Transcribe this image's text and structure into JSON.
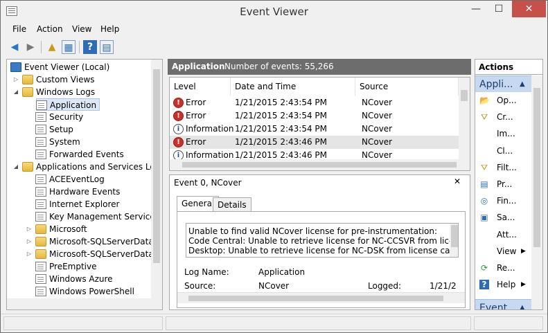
{
  "window": {
    "title": "Event Viewer",
    "min": "—",
    "max": "☐",
    "close": "✕"
  },
  "menubar": {
    "items": [
      "File",
      "Action",
      "View",
      "Help"
    ]
  },
  "toolbar": {
    "back": "◀",
    "forward": "▶",
    "up": "▲",
    "show": "▦",
    "help": "?",
    "props": "▤"
  },
  "tree": {
    "items": [
      {
        "label": "Event Viewer (Local)",
        "arrow": "",
        "icon": "monitor"
      },
      {
        "label": "Custom Views",
        "arrow": "▷",
        "icon": "folder"
      },
      {
        "label": "Windows Logs",
        "arrow": "◢",
        "icon": "folder"
      },
      {
        "label": "Application",
        "arrow": "",
        "icon": "log"
      },
      {
        "label": "Security",
        "arrow": "",
        "icon": "log"
      },
      {
        "label": "Setup",
        "arrow": "",
        "icon": "log"
      },
      {
        "label": "System",
        "arrow": "",
        "icon": "log"
      },
      {
        "label": "Forwarded Events",
        "arrow": "",
        "icon": "log"
      },
      {
        "label": "Applications and Services Logs",
        "arrow": "◢",
        "icon": "folder"
      },
      {
        "label": "ACEEventLog",
        "arrow": "",
        "icon": "log"
      },
      {
        "label": "Hardware Events",
        "arrow": "",
        "icon": "log"
      },
      {
        "label": "Internet Explorer",
        "arrow": "",
        "icon": "log"
      },
      {
        "label": "Key Management Service",
        "arrow": "",
        "icon": "log"
      },
      {
        "label": "Microsoft",
        "arrow": "▷",
        "icon": "folder"
      },
      {
        "label": "Microsoft-SQLServerDataTc",
        "arrow": "▷",
        "icon": "folder"
      },
      {
        "label": "Microsoft-SQLServerDataTc",
        "arrow": "▷",
        "icon": "folder"
      },
      {
        "label": "PreEmptive",
        "arrow": "",
        "icon": "log"
      },
      {
        "label": "Windows Azure",
        "arrow": "",
        "icon": "log"
      },
      {
        "label": "Windows PowerShell",
        "arrow": "",
        "icon": "log"
      }
    ]
  },
  "center": {
    "log_name": "Application",
    "count_label": "Number of events: 55,266"
  },
  "events": {
    "columns": [
      "Level",
      "Date and Time",
      "Source"
    ],
    "rows": [
      {
        "level": "Error",
        "date": "1/21/2015 2:43:54 PM",
        "source": "NCover"
      },
      {
        "level": "Error",
        "date": "1/21/2015 2:43:54 PM",
        "source": "NCover"
      },
      {
        "level": "Information",
        "date": "1/21/2015 2:43:54 PM",
        "source": "NCover"
      },
      {
        "level": "Error",
        "date": "1/21/2015 2:43:46 PM",
        "source": "NCover"
      },
      {
        "level": "Information",
        "date": "1/21/2015 2:43:46 PM",
        "source": "NCover"
      }
    ]
  },
  "detail": {
    "title": "Event 0, NCover",
    "close": "✕",
    "tabs": [
      "General",
      "Details"
    ],
    "message": [
      "Unable to find valid NCover license for pre-instrumentation:",
      "Code Central: Unable to retrieve license for NC-CCSVR from license cach",
      "Desktop: Unable to retrieve license for NC-DSK from license cache."
    ],
    "log_name_label": "Log Name:",
    "log_name_value": "Application",
    "source_label": "Source:",
    "source_value": "NCover",
    "logged_label": "Logged:",
    "logged_value": "1/21/2"
  },
  "actions": {
    "title": "Actions",
    "section1": "Appli...",
    "section2": "Event ...",
    "items": [
      {
        "label": "Op...",
        "icon": "📂"
      },
      {
        "label": "Cr...",
        "icon": "⛛"
      },
      {
        "label": "Im...",
        "icon": ""
      },
      {
        "label": "Cl...",
        "icon": ""
      },
      {
        "label": "Filt...",
        "icon": "⛛"
      },
      {
        "label": "Pr...",
        "icon": "▤"
      },
      {
        "label": "Fin...",
        "icon": "◎"
      },
      {
        "label": "Sa...",
        "icon": "▣"
      },
      {
        "label": "Att...",
        "icon": ""
      },
      {
        "label": "View",
        "icon": ""
      },
      {
        "label": "Re...",
        "icon": "⟳"
      },
      {
        "label": "Help",
        "icon": "?"
      }
    ]
  }
}
